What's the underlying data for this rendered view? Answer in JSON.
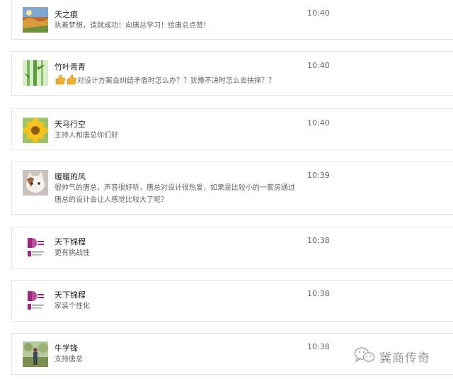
{
  "comments": [
    {
      "name": "天之痕",
      "time": "10:40",
      "text": "执着梦想，造就成功！向唐总学习！给唐总点赞！",
      "avatar": "landscape-avatar"
    },
    {
      "name": "竹叶青青",
      "time": "10:40",
      "text": "对设计方案会纠结矛盾时怎么办？？犹豫不决时怎么去抉择？？",
      "avatar": "bamboo-avatar",
      "emoji": "thumbs-up-icon"
    },
    {
      "name": "天马行空",
      "time": "10:40",
      "text": "主持人和唐总你们好",
      "avatar": "sunflower-avatar"
    },
    {
      "name": "暖暖的风",
      "time": "10:39",
      "text_line1": "很帅气的唐总，声音很好听，唐总对设计很热爱，如果是比较小的一套房通过",
      "text_line2": "唐总的设计会让人感觉比较大了呢？",
      "avatar": "cat-avatar"
    },
    {
      "name": "天下锦程",
      "time": "10:38",
      "text": "更有挑战性",
      "avatar": "brand-logo-avatar"
    },
    {
      "name": "天下锦程",
      "time": "10:38",
      "text": "家装个性化",
      "avatar": "brand-logo-avatar"
    },
    {
      "name": "牛学锋",
      "time": "10:38",
      "text": "支持唐总",
      "avatar": "outdoor-person-avatar"
    }
  ],
  "watermark": {
    "text": "冀商传奇",
    "icon": "wechat-icon"
  },
  "colors": {
    "border": "#e3e3e3",
    "name": "#222222",
    "text": "#666666",
    "brand": "#9b2a7d"
  }
}
